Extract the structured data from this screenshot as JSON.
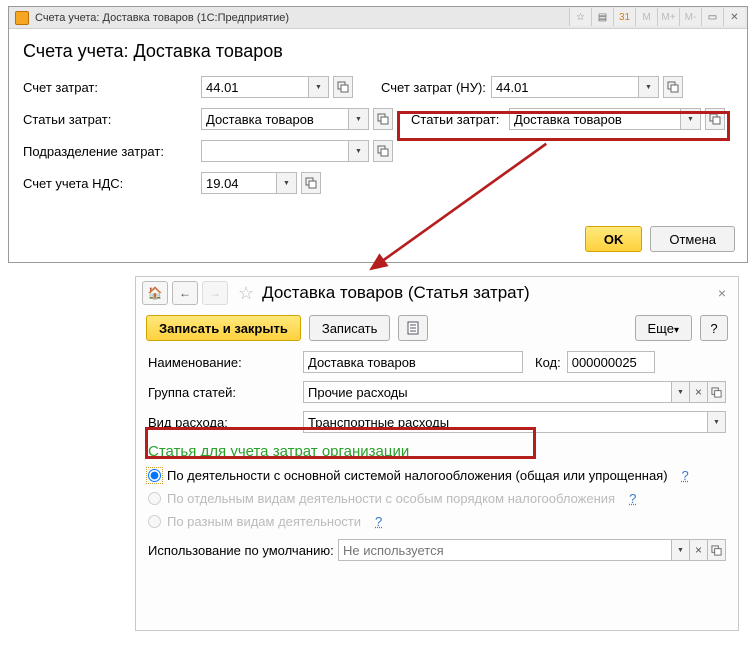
{
  "win1": {
    "title": "Счета учета: Доставка товаров  (1С:Предприятие)",
    "header": "Счета учета: Доставка товаров",
    "labels": {
      "schet_zatrat": "Счет затрат:",
      "schet_zatrat_nu": "Счет затрат (НУ):",
      "stati_zatrat": "Статьи затрат:",
      "stati_zatrat2": "Статьи затрат:",
      "podrazdelenie": "Подразделение затрат:",
      "schet_nds": "Счет учета НДС:"
    },
    "values": {
      "schet_zatrat": "44.01",
      "schet_zatrat_nu": "44.01",
      "stati_zatrat": "Доставка товаров",
      "stati_zatrat2": "Доставка товаров",
      "podrazdelenie": "",
      "schet_nds": "19.04"
    },
    "ok": "OK",
    "cancel": "Отмена",
    "m_buttons": [
      "M",
      "M+",
      "M-"
    ]
  },
  "win2": {
    "title": "Доставка товаров (Статья затрат)",
    "actions": {
      "write_close": "Записать и закрыть",
      "write": "Записать",
      "more": "Еще",
      "help": "?"
    },
    "labels": {
      "name": "Наименование:",
      "code": "Код:",
      "group": "Группа статей:",
      "vid": "Вид расхода:",
      "use_default": "Использование по умолчанию:"
    },
    "values": {
      "name": "Доставка товаров",
      "code": "000000025",
      "group": "Прочие расходы",
      "vid": "Транспортные расходы",
      "use_default": ""
    },
    "placeholders": {
      "use_default": "Не используется"
    },
    "section": "Статья для учета затрат организации",
    "radios": {
      "r1": "По деятельности с основной системой налогообложения (общая или упрощенная)",
      "r2": "По отдельным видам деятельности с особым порядком налогообложения",
      "r3": "По разным видам деятельности"
    },
    "qmark": "?"
  }
}
